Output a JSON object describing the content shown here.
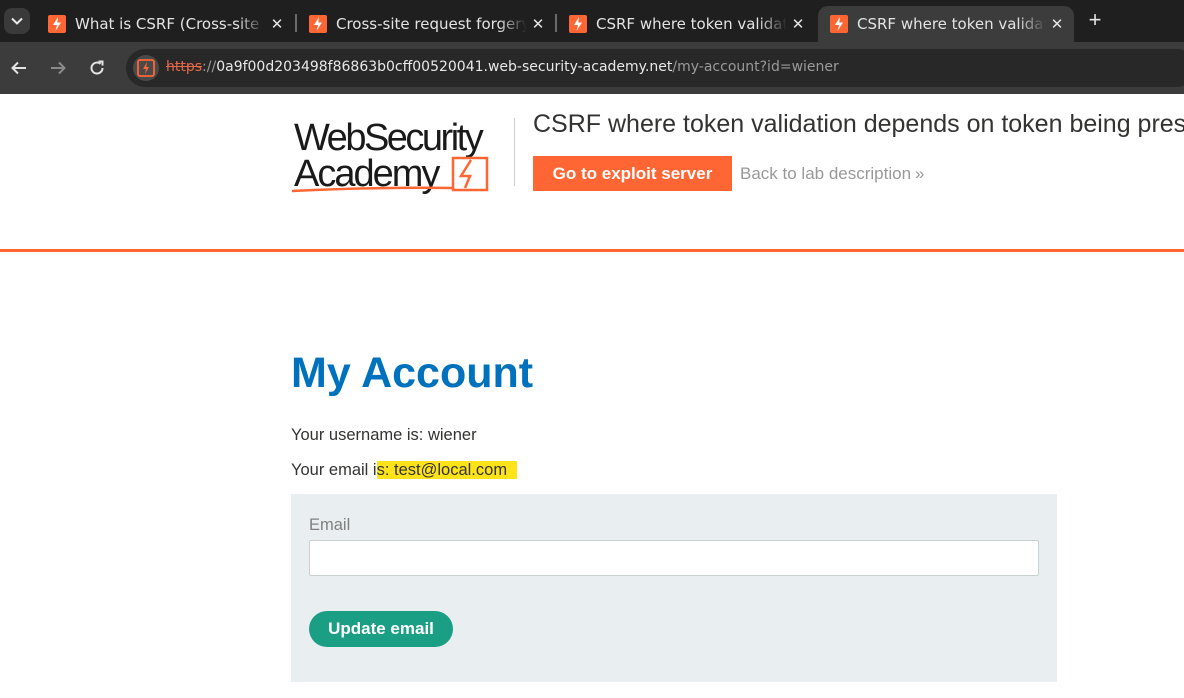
{
  "browser": {
    "tabs": [
      {
        "title": "What is CSRF (Cross-site request forgery)?",
        "active": false
      },
      {
        "title": "Cross-site request forgery (CSRF)",
        "active": false
      },
      {
        "title": "CSRF where token validation depends on request method",
        "active": false
      },
      {
        "title": "CSRF where token validation depends on token being present",
        "active": true
      }
    ],
    "new_tab_label": "+",
    "url": {
      "scheme": "https",
      "separator": "://",
      "host": "0a9f00d203498f86863b0cff00520041.web-security-academy.net",
      "path": "/my-account?id=wiener"
    },
    "favicon_color": "#ff6633"
  },
  "header": {
    "logo_line1": "WebSecurity",
    "logo_line2": "Academy",
    "lab_title": "CSRF where token validation depends on token being present",
    "exploit_button": "Go to exploit server",
    "back_link": "Back to lab description",
    "back_link_chevron": "»",
    "accent_color": "#ff6633"
  },
  "main": {
    "heading": "My Account",
    "username_line": "Your username is: wiener",
    "email_prefix": "Your email i",
    "email_highlighted": "s: test@local.com",
    "highlight_color": "#ffe31a",
    "form": {
      "email_label": "Email",
      "email_value": "",
      "submit_label": "Update email"
    },
    "heading_color": "#0071bc",
    "button_color": "#1a9f84"
  }
}
